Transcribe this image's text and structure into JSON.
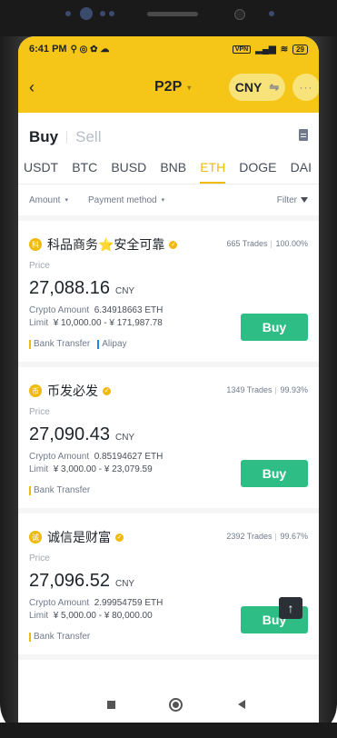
{
  "status": {
    "time": "6:41 PM",
    "battery": "29",
    "vpn": "VPN"
  },
  "header": {
    "back": "‹",
    "title": "P2P",
    "title_caret": "▾",
    "currency": "CNY",
    "swap_icon": "⇋",
    "more": "···"
  },
  "mode": {
    "buy": "Buy",
    "sell": "Sell"
  },
  "coins": [
    "USDT",
    "BTC",
    "BUSD",
    "BNB",
    "ETH",
    "DOGE",
    "DAI"
  ],
  "active_coin": "ETH",
  "filters": {
    "amount": "Amount",
    "payment": "Payment method",
    "filter": "Filter",
    "caret": "▾"
  },
  "labels": {
    "price": "Price",
    "crypto_amount": "Crypto Amount",
    "limit": "Limit",
    "buy": "Buy",
    "trades": "Trades"
  },
  "offers": [
    {
      "merchant": "科品商务⭐安全可靠",
      "trades": "665 Trades",
      "completion": "100.00%",
      "price": "27,088.16",
      "currency": "CNY",
      "amount": "6.34918663 ETH",
      "limit": "¥ 10,000.00 - ¥ 171,987.78",
      "methods": [
        {
          "name": "Bank Transfer",
          "color": "#f0b90b"
        },
        {
          "name": "Alipay",
          "color": "#1e88e5"
        }
      ]
    },
    {
      "merchant": "币发必发",
      "trades": "1349 Trades",
      "completion": "99.93%",
      "price": "27,090.43",
      "currency": "CNY",
      "amount": "0.85194627 ETH",
      "limit": "¥ 3,000.00 - ¥ 23,079.59",
      "methods": [
        {
          "name": "Bank Transfer",
          "color": "#f0b90b"
        }
      ]
    },
    {
      "merchant": "诚信是财富",
      "trades": "2392 Trades",
      "completion": "99.67%",
      "price": "27,096.52",
      "currency": "CNY",
      "amount": "2.99954759 ETH",
      "limit": "¥ 5,000.00 - ¥ 80,000.00",
      "methods": [
        {
          "name": "Bank Transfer",
          "color": "#f0b90b"
        }
      ]
    }
  ],
  "colors": {
    "brand_yellow": "#f5c518",
    "accent": "#f0b90b",
    "buy_green": "#2ebd85"
  },
  "icons": {
    "scroll_top": "up-arrow-icon",
    "document": "document-icon",
    "filter": "funnel-icon"
  }
}
